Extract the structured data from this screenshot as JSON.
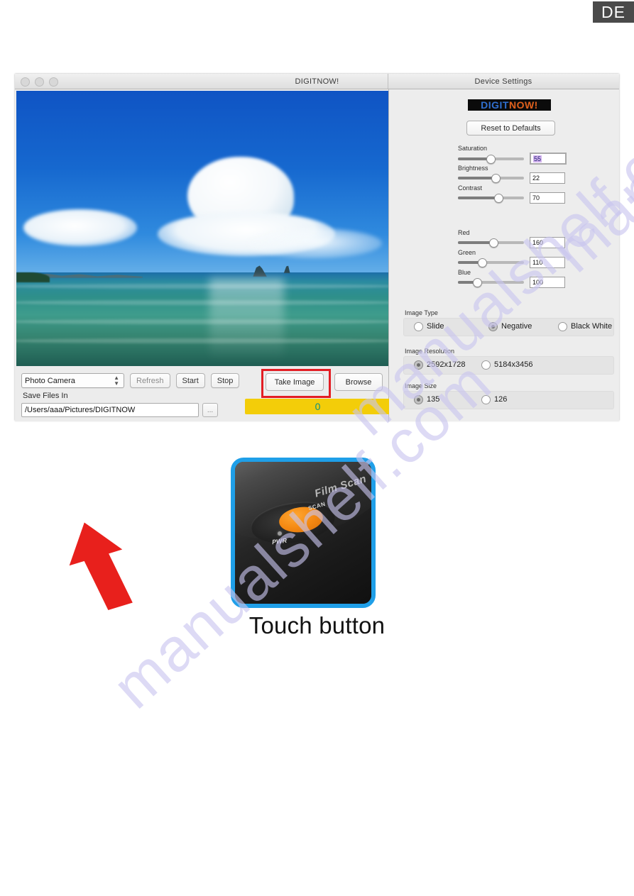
{
  "page": {
    "language_badge": "DE"
  },
  "watermark": {
    "text": "manualshelf.com",
    "color": "#c9c5ef"
  },
  "window": {
    "title": "DIGITNOW!",
    "traffic_lights": [
      "close-button",
      "minimize-button",
      "zoom-button"
    ]
  },
  "preview": {
    "description": "tropical seascape with blue sky, cumulus clouds and green-blue sea"
  },
  "controls": {
    "device_select": {
      "value": "Photo Camera",
      "options": [
        "Photo Camera"
      ]
    },
    "refresh_label": "Refresh",
    "start_label": "Start",
    "stop_label": "Stop",
    "take_image_label": "Take Image",
    "browse_label": "Browse",
    "save_files_in_label": "Save Files In",
    "save_path": "/Users/aaa/Pictures/DIGITNOW",
    "dots_label": "...",
    "progress_value": "0",
    "progress_color": "#f3cd09",
    "progress_text_color": "#0b8f86",
    "highlight_color": "#e31e24"
  },
  "device_settings": {
    "panel_title": "Device Settings",
    "logo": {
      "part1": "DIGIT",
      "part2": "NOW!",
      "part1_color": "#2f6fd0",
      "part2_color": "#e0601c"
    },
    "reset_label": "Reset to Defaults",
    "sliders": [
      {
        "label": "Saturation",
        "value": "55",
        "percent": 48,
        "focused": true
      },
      {
        "label": "Brightness",
        "value": "22",
        "percent": 55,
        "focused": false
      },
      {
        "label": "Contrast",
        "value": "70",
        "percent": 60,
        "focused": false
      },
      {
        "label": "Red",
        "value": "160",
        "percent": 52,
        "focused": false
      },
      {
        "label": "Green",
        "value": "110",
        "percent": 35,
        "focused": false
      },
      {
        "label": "Blue",
        "value": "100",
        "percent": 28,
        "focused": false
      }
    ],
    "image_type": {
      "label": "Image Type",
      "options": [
        {
          "label": "Slide",
          "selected": false
        },
        {
          "label": "Negative",
          "selected": true
        },
        {
          "label": "Black White",
          "selected": false
        }
      ]
    },
    "image_resolution": {
      "label": "Image Resolution",
      "options": [
        {
          "label": "2592x1728",
          "selected": true
        },
        {
          "label": "5184x3456",
          "selected": false
        }
      ]
    },
    "image_size": {
      "label": "Image Size",
      "options": [
        {
          "label": "135",
          "selected": true
        },
        {
          "label": "126",
          "selected": false
        }
      ]
    }
  },
  "photo": {
    "caption": "Touch button",
    "device_brand_text": "Film Scan",
    "scan_button_text": "SCAN",
    "power_label": "PWR",
    "frame_color": "#1f9fe8",
    "arrow_color": "#e8201c",
    "button_color": "#f58a13"
  }
}
